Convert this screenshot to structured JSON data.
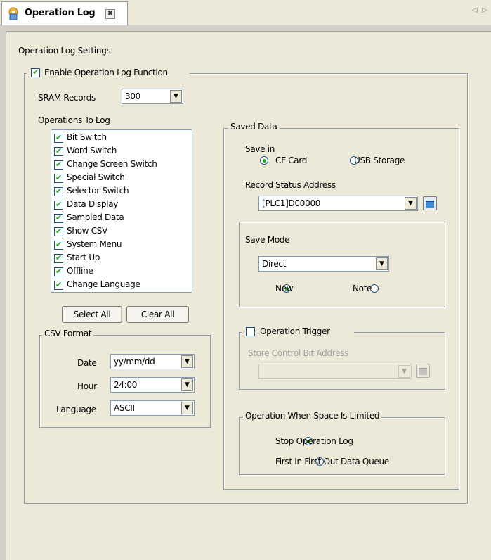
{
  "tab": {
    "title": "Operation Log",
    "close_glyph": "✖",
    "scroll_left": "◁",
    "scroll_right": "▷",
    "icon": "operation-log-icon"
  },
  "settings_title": "Operation Log Settings",
  "enable": {
    "label": "Enable Operation Log Function",
    "checked": true
  },
  "sram": {
    "label": "SRAM Records",
    "value": "300"
  },
  "operations": {
    "label": "Operations To Log",
    "items": [
      {
        "label": "Bit Switch",
        "checked": true
      },
      {
        "label": "Word Switch",
        "checked": true
      },
      {
        "label": "Change Screen Switch",
        "checked": true
      },
      {
        "label": "Special Switch",
        "checked": true
      },
      {
        "label": "Selector Switch",
        "checked": true
      },
      {
        "label": "Data Display",
        "checked": true
      },
      {
        "label": "Sampled Data",
        "checked": true
      },
      {
        "label": "Show CSV",
        "checked": true
      },
      {
        "label": "System Menu",
        "checked": true
      },
      {
        "label": "Start Up",
        "checked": true
      },
      {
        "label": "Offline",
        "checked": true
      },
      {
        "label": "Change Language",
        "checked": true
      }
    ]
  },
  "buttons": {
    "select_all": "Select All",
    "clear_all": "Clear All"
  },
  "csv": {
    "legend": "CSV Format",
    "date_label": "Date",
    "date_value": "yy/mm/dd",
    "hour_label": "Hour",
    "hour_value": "24:00",
    "language_label": "Language",
    "language_value": "ASCII"
  },
  "saved": {
    "legend": "Saved Data",
    "save_in_label": "Save in",
    "cf_card": "CF Card",
    "usb": "USB Storage",
    "save_in_selected": "CF Card",
    "record_status_label": "Record Status Address",
    "record_status_value": "[PLC1]D00000",
    "save_mode_label": "Save Mode",
    "save_mode_value": "Direct",
    "new": "New",
    "note": "Note",
    "mode_selected": "New",
    "trigger_label": "Operation Trigger",
    "trigger_checked": false,
    "store_control_label": "Store Control Bit Address",
    "store_control_value": "",
    "space_legend": "Operation When Space Is Limited",
    "stop": "Stop Operation Log",
    "fifo": "First In First Out Data Queue",
    "space_selected": "Stop Operation Log"
  },
  "colors": {
    "panel": "#ece9d8",
    "check": "#21a121",
    "border": "#7f9db9"
  }
}
